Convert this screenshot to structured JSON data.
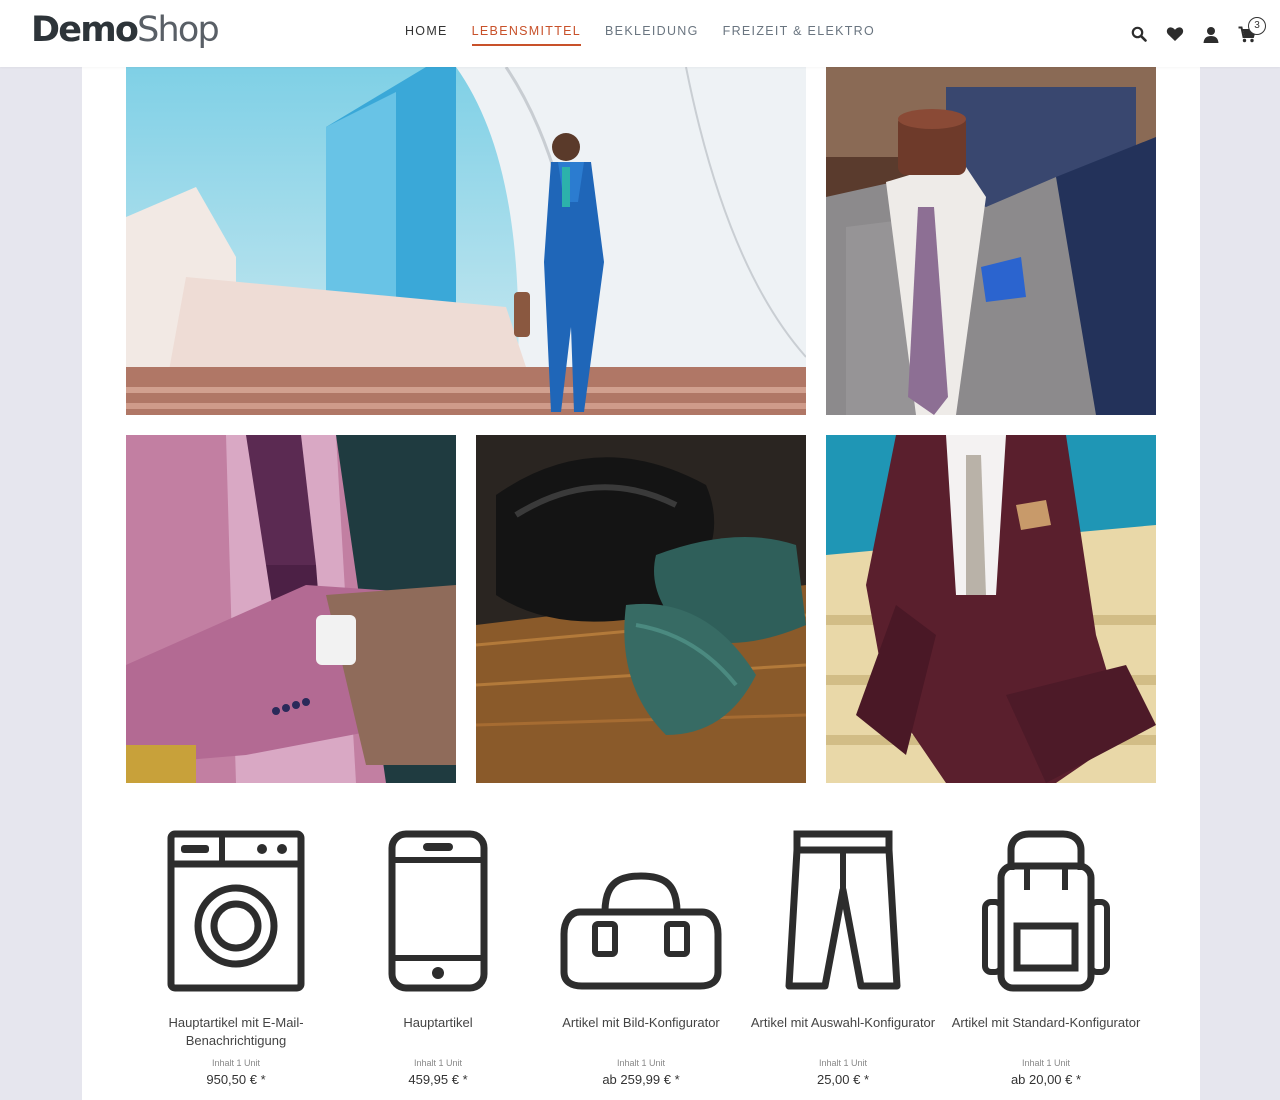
{
  "header": {
    "logo_part1": "Demo",
    "logo_part2": "Shop",
    "nav": [
      "HOME",
      "LEBENSMITTEL",
      "BEKLEIDUNG",
      "FREIZEIT & ELEKTRO"
    ],
    "active_nav": "LEBENSMITTEL",
    "icons": [
      "search-icon",
      "heart-icon",
      "user-icon",
      "cart-icon"
    ],
    "cart_count": "3"
  },
  "colors": {
    "accent": "#c8512a",
    "icon_dark": "#2d2d2d",
    "page_bg": "#e6e6ee"
  },
  "gallery": [
    "businessman-blue-suit-photo",
    "plaid-suit-mannequin-photo",
    "pink-blazer-photo",
    "leather-shoes-green-tie-photo",
    "burgundy-suit-stairs-photo"
  ],
  "products": [
    {
      "icon": "washing-machine-icon",
      "name": "Hauptartikel mit E-Mail-Benachrichtigung",
      "unit": "Inhalt 1 Unit",
      "price": "950,50 € *"
    },
    {
      "icon": "smartphone-icon",
      "name": "Hauptartikel",
      "unit": "Inhalt 1 Unit",
      "price": "459,95 € *"
    },
    {
      "icon": "bag-icon",
      "name": "Artikel mit Bild-Konfigurator",
      "unit": "Inhalt 1 Unit",
      "price": "ab 259,99 € *"
    },
    {
      "icon": "trousers-icon",
      "name": "Artikel mit Auswahl-Konfigurator",
      "unit": "Inhalt 1 Unit",
      "price": "25,00 € *"
    },
    {
      "icon": "backpack-icon",
      "name": "Artikel mit Standard-Konfigurator",
      "unit": "Inhalt 1 Unit",
      "price": "ab 20,00 € *"
    }
  ]
}
